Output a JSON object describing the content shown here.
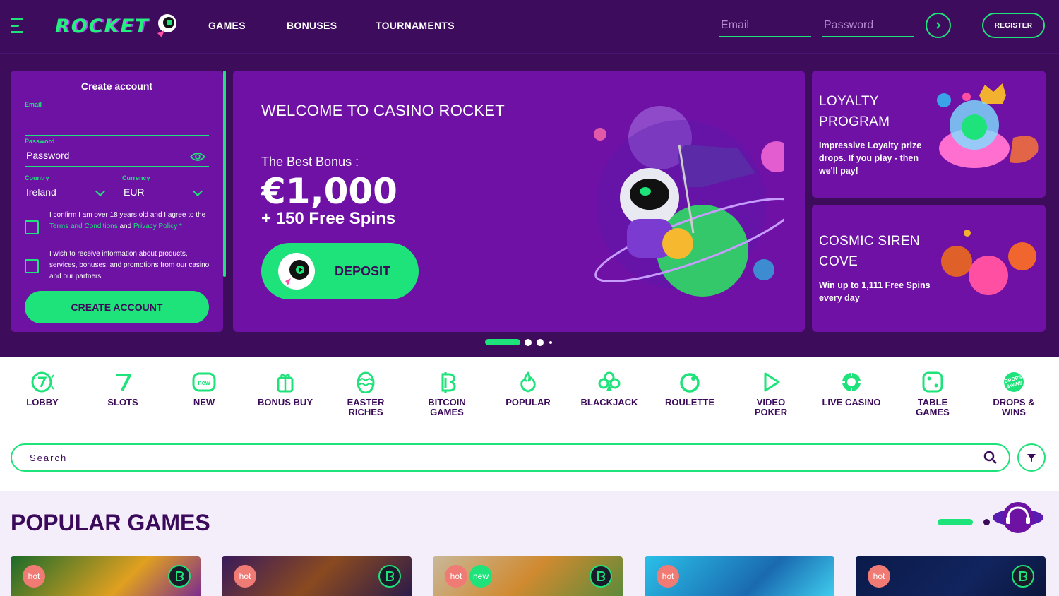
{
  "header": {
    "logo_text": "ROCKET",
    "nav": [
      "GAMES",
      "BONUSES",
      "TOURNAMENTS"
    ],
    "email_placeholder": "Email",
    "password_placeholder": "Password",
    "register_label": "REGISTER"
  },
  "create_account": {
    "title": "Create account",
    "email_label": "Email",
    "email_value": "",
    "password_label": "Password",
    "password_value": "Password",
    "country_label": "Country",
    "country_value": "Ireland",
    "currency_label": "Currency",
    "currency_value": "EUR",
    "confirm_pre": "I confirm I am over 18 years old and I agree to the ",
    "terms_link": "Terms and Conditions",
    "confirm_and": " and ",
    "privacy_link": "Privacy Policy",
    "confirm_star": " *",
    "marketing_text": "I wish to receive information about products, services, bonuses, and promotions from our casino and our partners",
    "button_label": "CREATE ACCOUNT"
  },
  "banner": {
    "title": "WELCOME TO CASINO ROCKET",
    "subtitle": "The Best Bonus :",
    "amount": "€1,000",
    "spins": "+ 150 Free Spins",
    "deposit_label": "DEPOSIT"
  },
  "promos": [
    {
      "title_line1": "LOYALTY",
      "title_line2": "PROGRAM",
      "text": "Impressive Loyalty prize drops. If you play - then we'll pay!"
    },
    {
      "title_line1": "COSMIC SIREN",
      "title_line2": "COVE",
      "text": "Win up to 1,111 Free Spins every day"
    }
  ],
  "carousel": {
    "active_index": 0,
    "count": 4
  },
  "categories": [
    {
      "line1": "LOBBY",
      "line2": "",
      "icon": "lobby-icon"
    },
    {
      "line1": "SLOTS",
      "line2": "",
      "icon": "slots-icon"
    },
    {
      "line1": "NEW",
      "line2": "",
      "icon": "new-icon",
      "badge": "new"
    },
    {
      "line1": "BONUS BUY",
      "line2": "",
      "icon": "gift-icon"
    },
    {
      "line1": "EASTER",
      "line2": "RICHES",
      "icon": "egg-icon"
    },
    {
      "line1": "BITCOIN",
      "line2": "GAMES",
      "icon": "bitcoin-icon"
    },
    {
      "line1": "POPULAR",
      "line2": "",
      "icon": "fire-icon"
    },
    {
      "line1": "BLACKJACK",
      "line2": "",
      "icon": "clubs-icon"
    },
    {
      "line1": "ROULETTE",
      "line2": "",
      "icon": "roulette-icon"
    },
    {
      "line1": "VIDEO",
      "line2": "POKER",
      "icon": "play-icon"
    },
    {
      "line1": "LIVE CASINO",
      "line2": "",
      "icon": "live-icon"
    },
    {
      "line1": "TABLE",
      "line2": "GAMES",
      "icon": "dice-icon"
    },
    {
      "line1": "DROPS &",
      "line2": "WINS",
      "icon": "drops-icon",
      "badge_line1": "DROPS",
      "badge_line2": "&WINS"
    }
  ],
  "search": {
    "placeholder": "Search"
  },
  "popular": {
    "title": "POPULAR GAMES",
    "cards": [
      {
        "tags": [
          "hot"
        ],
        "bitcoin": true
      },
      {
        "tags": [
          "hot"
        ],
        "bitcoin": true
      },
      {
        "tags": [
          "hot",
          "new"
        ],
        "bitcoin": true
      },
      {
        "tags": [
          "hot"
        ],
        "bitcoin": false
      },
      {
        "tags": [
          "hot"
        ],
        "bitcoin": true
      }
    ]
  },
  "colors": {
    "accent": "#1ee37a",
    "header_bg": "#3e0c5d",
    "panel_bg": "#6e11a4",
    "text_dark": "#3b0a5a",
    "hot_tag": "#f07a74",
    "new_tag": "#1ee37a"
  }
}
